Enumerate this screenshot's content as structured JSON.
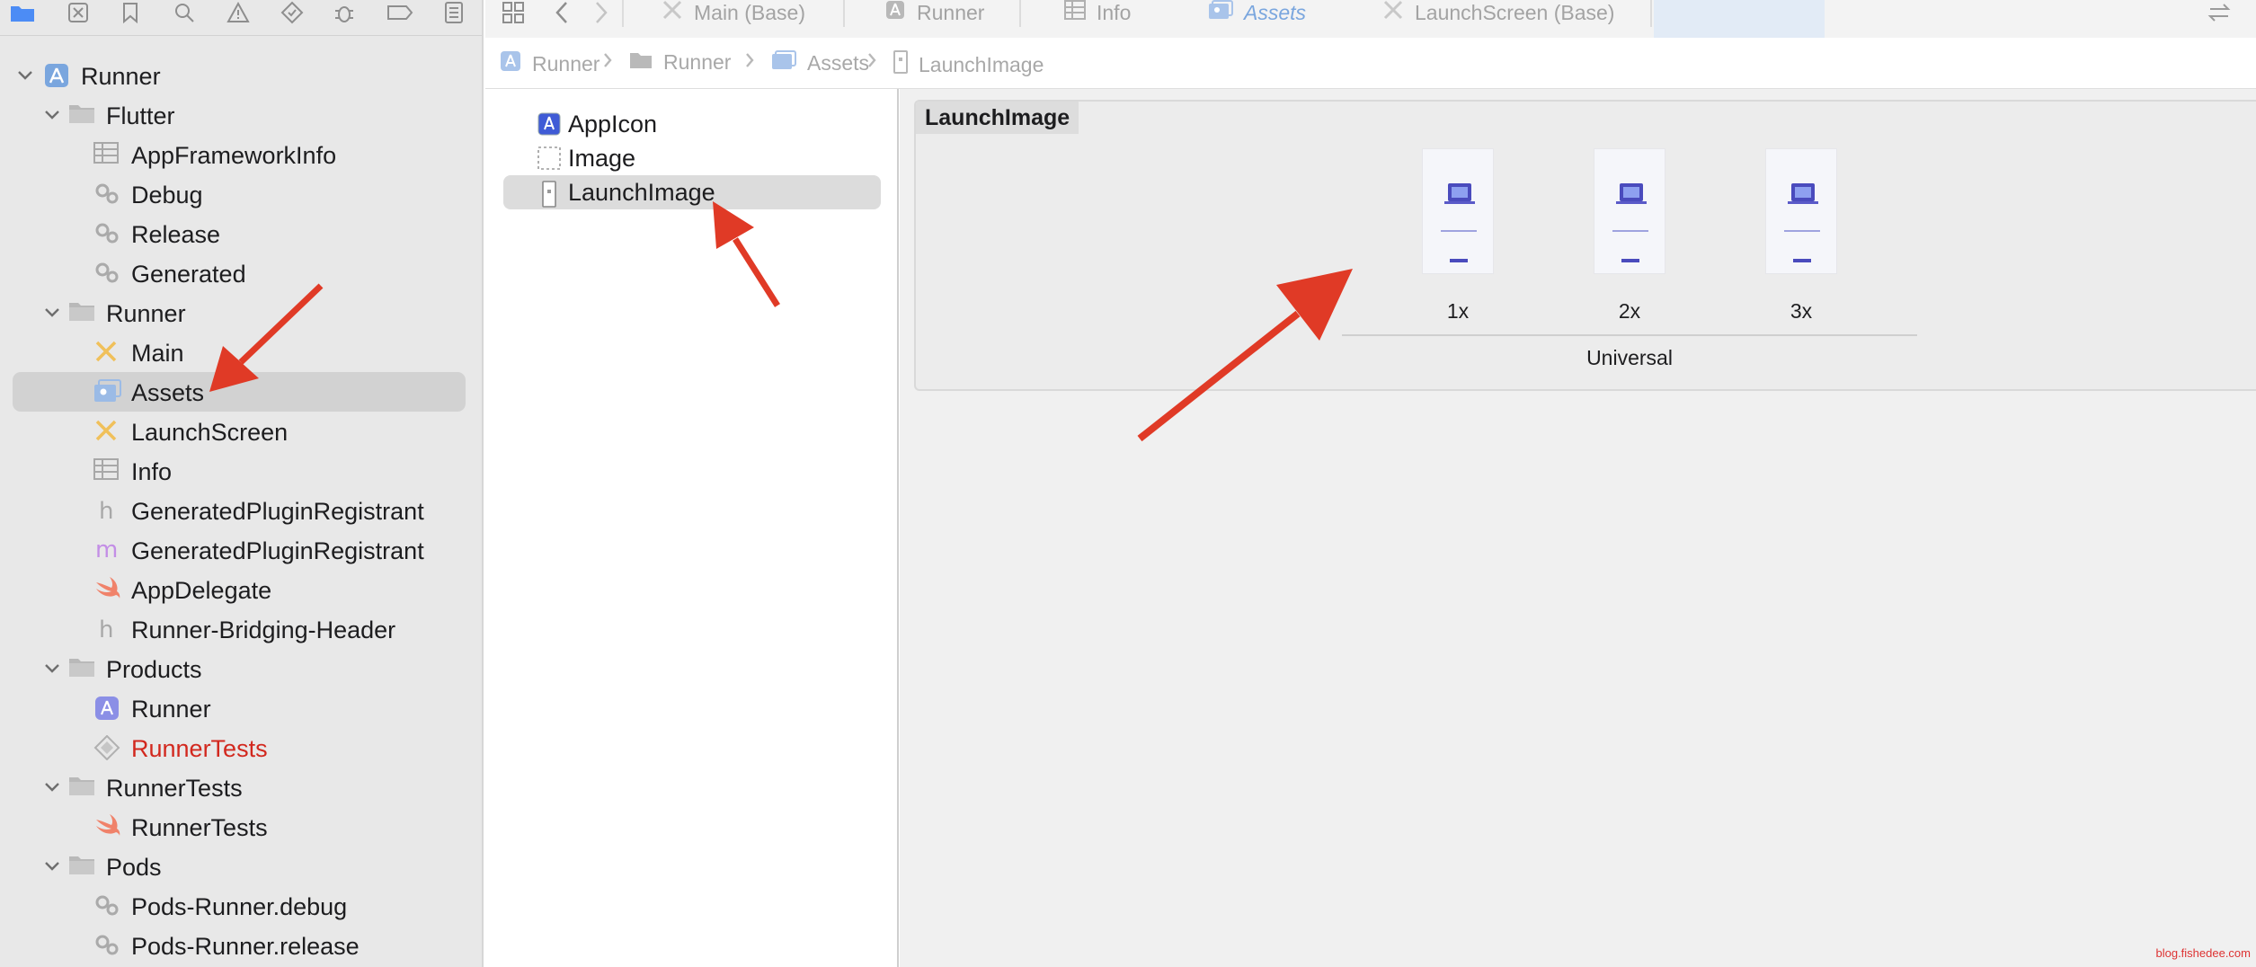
{
  "navigator": {
    "toolbar_icons": [
      "folder-icon",
      "source-control-icon",
      "bookmark-icon",
      "search-icon",
      "warning-icon",
      "test-icon",
      "debug-icon",
      "breakpoint-icon",
      "report-icon"
    ],
    "tree": [
      {
        "label": "Runner",
        "level": 0,
        "kind": "project",
        "expanded": true
      },
      {
        "label": "Flutter",
        "level": 1,
        "kind": "folder",
        "expanded": true
      },
      {
        "label": "AppFrameworkInfo",
        "level": 2,
        "kind": "plist"
      },
      {
        "label": "Debug",
        "level": 2,
        "kind": "config"
      },
      {
        "label": "Release",
        "level": 2,
        "kind": "config"
      },
      {
        "label": "Generated",
        "level": 2,
        "kind": "config"
      },
      {
        "label": "Runner",
        "level": 1,
        "kind": "folder",
        "expanded": true
      },
      {
        "label": "Main",
        "level": 2,
        "kind": "storyboard"
      },
      {
        "label": "Assets",
        "level": 2,
        "kind": "assets",
        "selected": true
      },
      {
        "label": "LaunchScreen",
        "level": 2,
        "kind": "storyboard"
      },
      {
        "label": "Info",
        "level": 2,
        "kind": "plist"
      },
      {
        "label": "GeneratedPluginRegistrant",
        "level": 2,
        "kind": "header"
      },
      {
        "label": "GeneratedPluginRegistrant",
        "level": 2,
        "kind": "objc"
      },
      {
        "label": "AppDelegate",
        "level": 2,
        "kind": "swift"
      },
      {
        "label": "Runner-Bridging-Header",
        "level": 2,
        "kind": "header"
      },
      {
        "label": "Products",
        "level": 1,
        "kind": "folder",
        "expanded": true
      },
      {
        "label": "Runner",
        "level": 2,
        "kind": "app"
      },
      {
        "label": "RunnerTests",
        "level": 2,
        "kind": "xctest",
        "missing": true
      },
      {
        "label": "RunnerTests",
        "level": 1,
        "kind": "folder",
        "expanded": true
      },
      {
        "label": "RunnerTests",
        "level": 2,
        "kind": "swift"
      },
      {
        "label": "Pods",
        "level": 1,
        "kind": "folder",
        "expanded": true
      },
      {
        "label": "Pods-Runner.debug",
        "level": 2,
        "kind": "config"
      },
      {
        "label": "Pods-Runner.release",
        "level": 2,
        "kind": "config"
      }
    ]
  },
  "tabs": [
    {
      "label": "Main (Base)",
      "icon": "storyboard-icon"
    },
    {
      "label": "Runner",
      "icon": "project-icon"
    },
    {
      "label": "Info",
      "icon": "plist-icon"
    },
    {
      "label": "Assets",
      "icon": "assets-icon",
      "active": true
    },
    {
      "label": "LaunchScreen (Base)",
      "icon": "storyboard-icon"
    }
  ],
  "breadcrumbs": [
    {
      "label": "Runner",
      "icon": "project-icon"
    },
    {
      "label": "Runner",
      "icon": "folder-icon"
    },
    {
      "label": "Assets",
      "icon": "assets-icon"
    },
    {
      "label": "LaunchImage",
      "icon": "launch-image-icon"
    }
  ],
  "asset_list": [
    {
      "label": "AppIcon",
      "icon": "app-icon-set-icon"
    },
    {
      "label": "Image",
      "icon": "image-set-icon"
    },
    {
      "label": "LaunchImage",
      "icon": "launch-image-icon",
      "selected": true
    }
  ],
  "detail": {
    "set_title": "LaunchImage",
    "slots": [
      {
        "label": "1x"
      },
      {
        "label": "2x"
      },
      {
        "label": "3x"
      }
    ],
    "group_label": "Universal"
  },
  "watermark": "blog.fishedee.com",
  "colors": {
    "accent": "#7aa6de",
    "arrow": "#e03a26",
    "missing_file": "#d2281e",
    "selection": "#d2d2d2"
  }
}
